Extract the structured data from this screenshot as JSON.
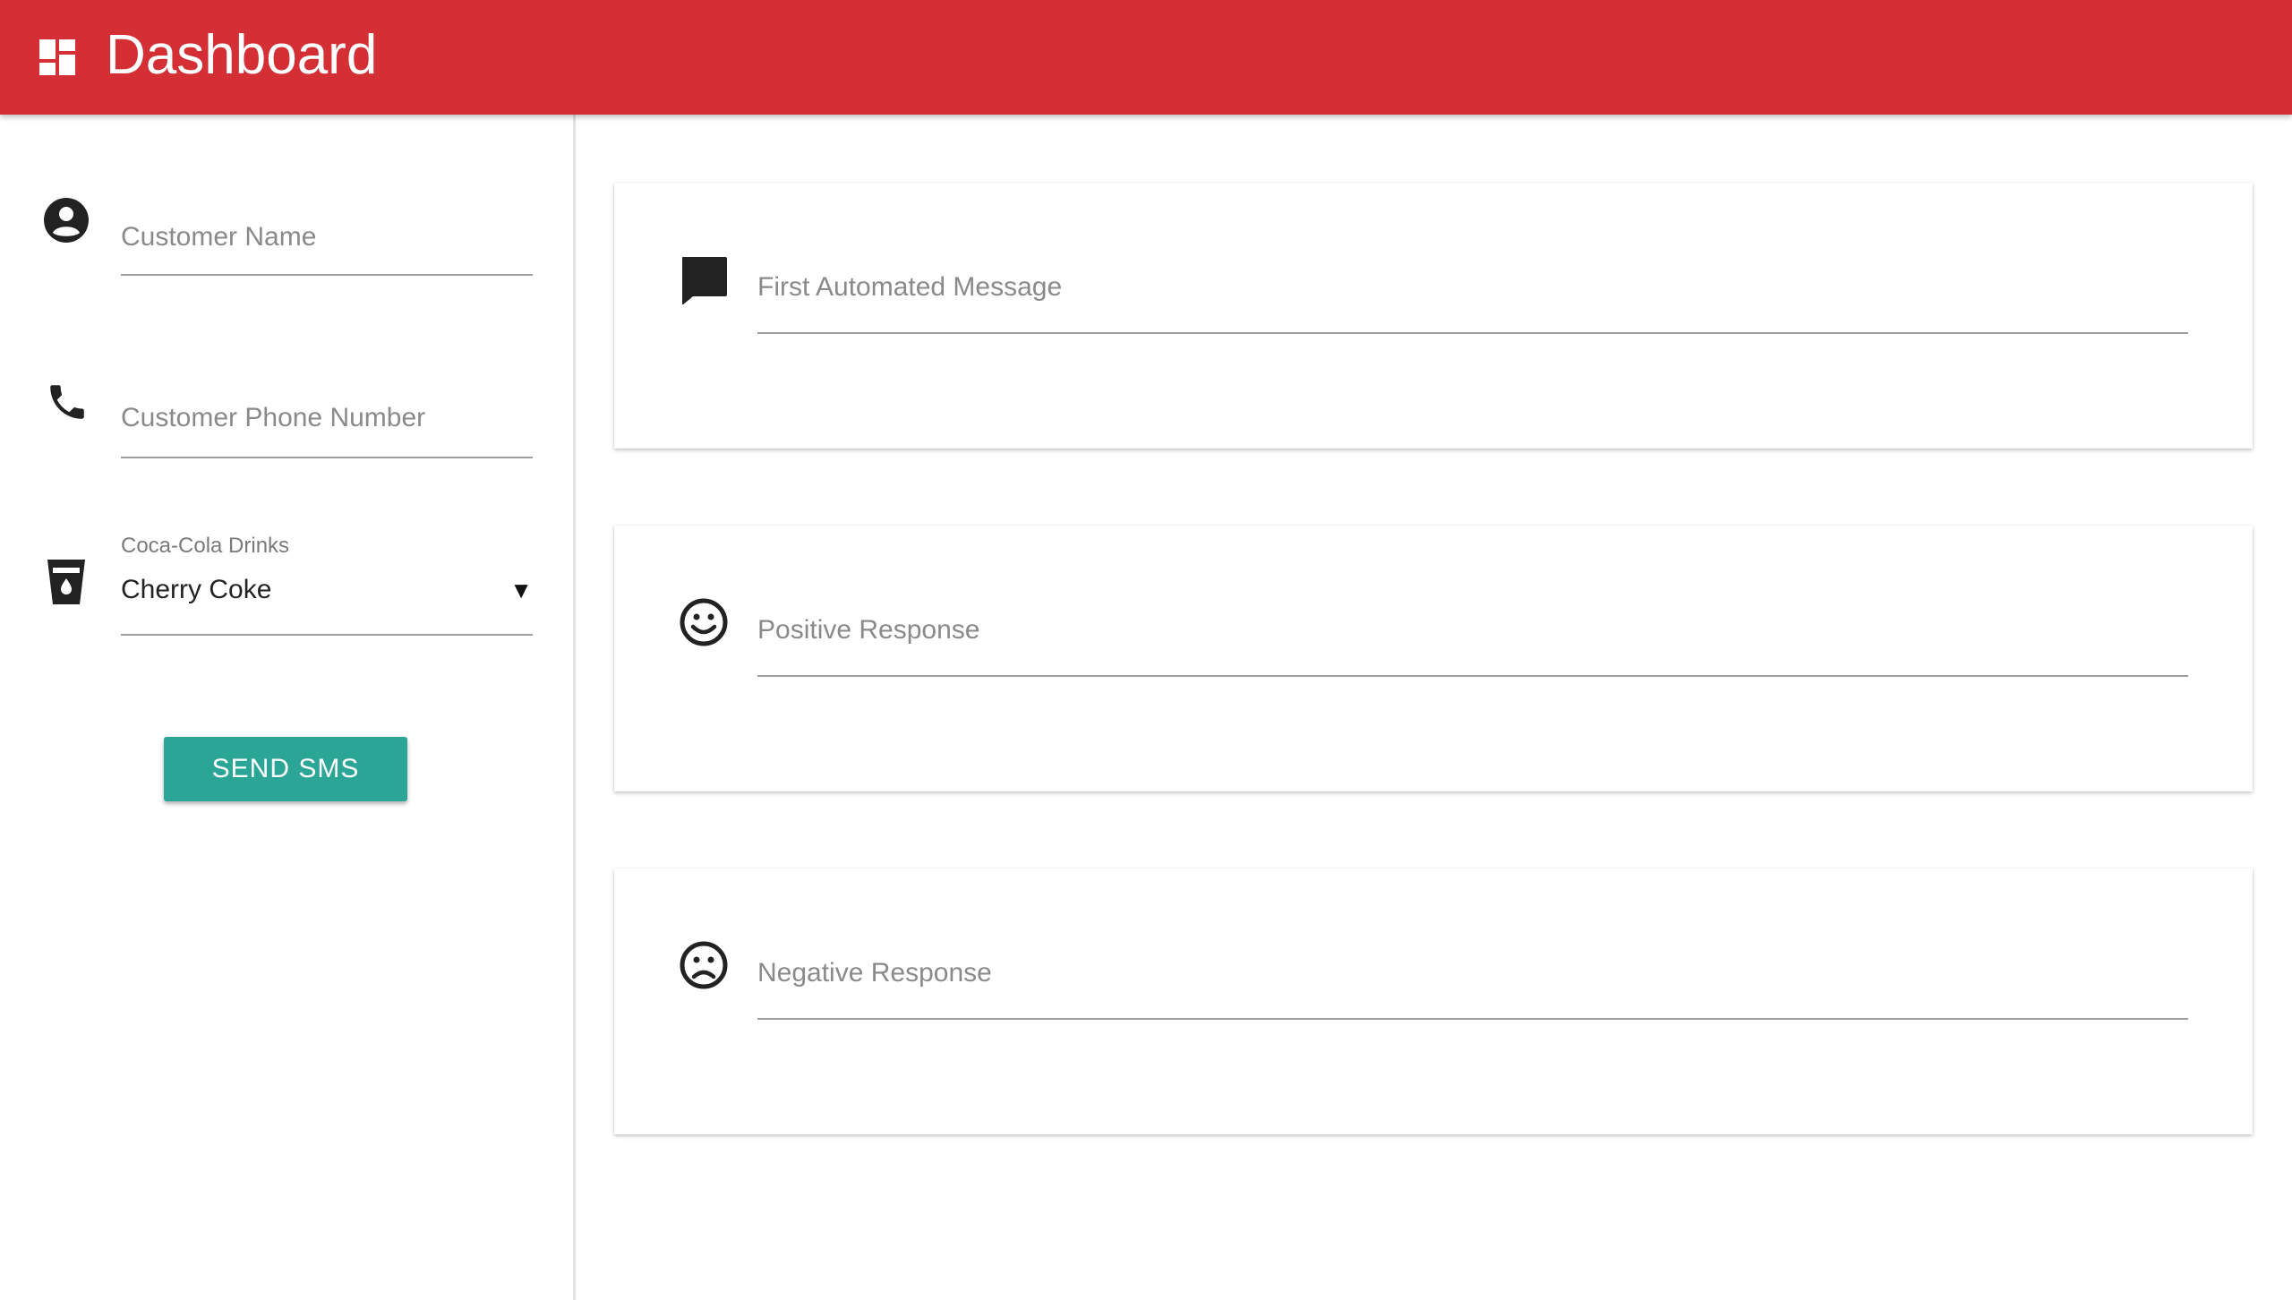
{
  "appbar": {
    "title": "Dashboard",
    "icon": "dashboard-icon",
    "color": "#d32f35"
  },
  "sidebar": {
    "customer_name": {
      "placeholder": "Customer Name",
      "icon": "account-circle-icon"
    },
    "customer_phone": {
      "placeholder": "Customer Phone Number",
      "icon": "phone-icon"
    },
    "drink_select": {
      "label": "Coca-Cola Drinks",
      "value": "Cherry Coke",
      "icon": "drink-cup-icon"
    },
    "send_button": {
      "label": "SEND SMS",
      "color": "#2ba596"
    }
  },
  "cards": [
    {
      "placeholder": "First Automated Message",
      "icon": "chat-bubble-icon"
    },
    {
      "placeholder": "Positive Response",
      "icon": "smiley-face-icon"
    },
    {
      "placeholder": "Negative Response",
      "icon": "sad-face-icon"
    }
  ]
}
